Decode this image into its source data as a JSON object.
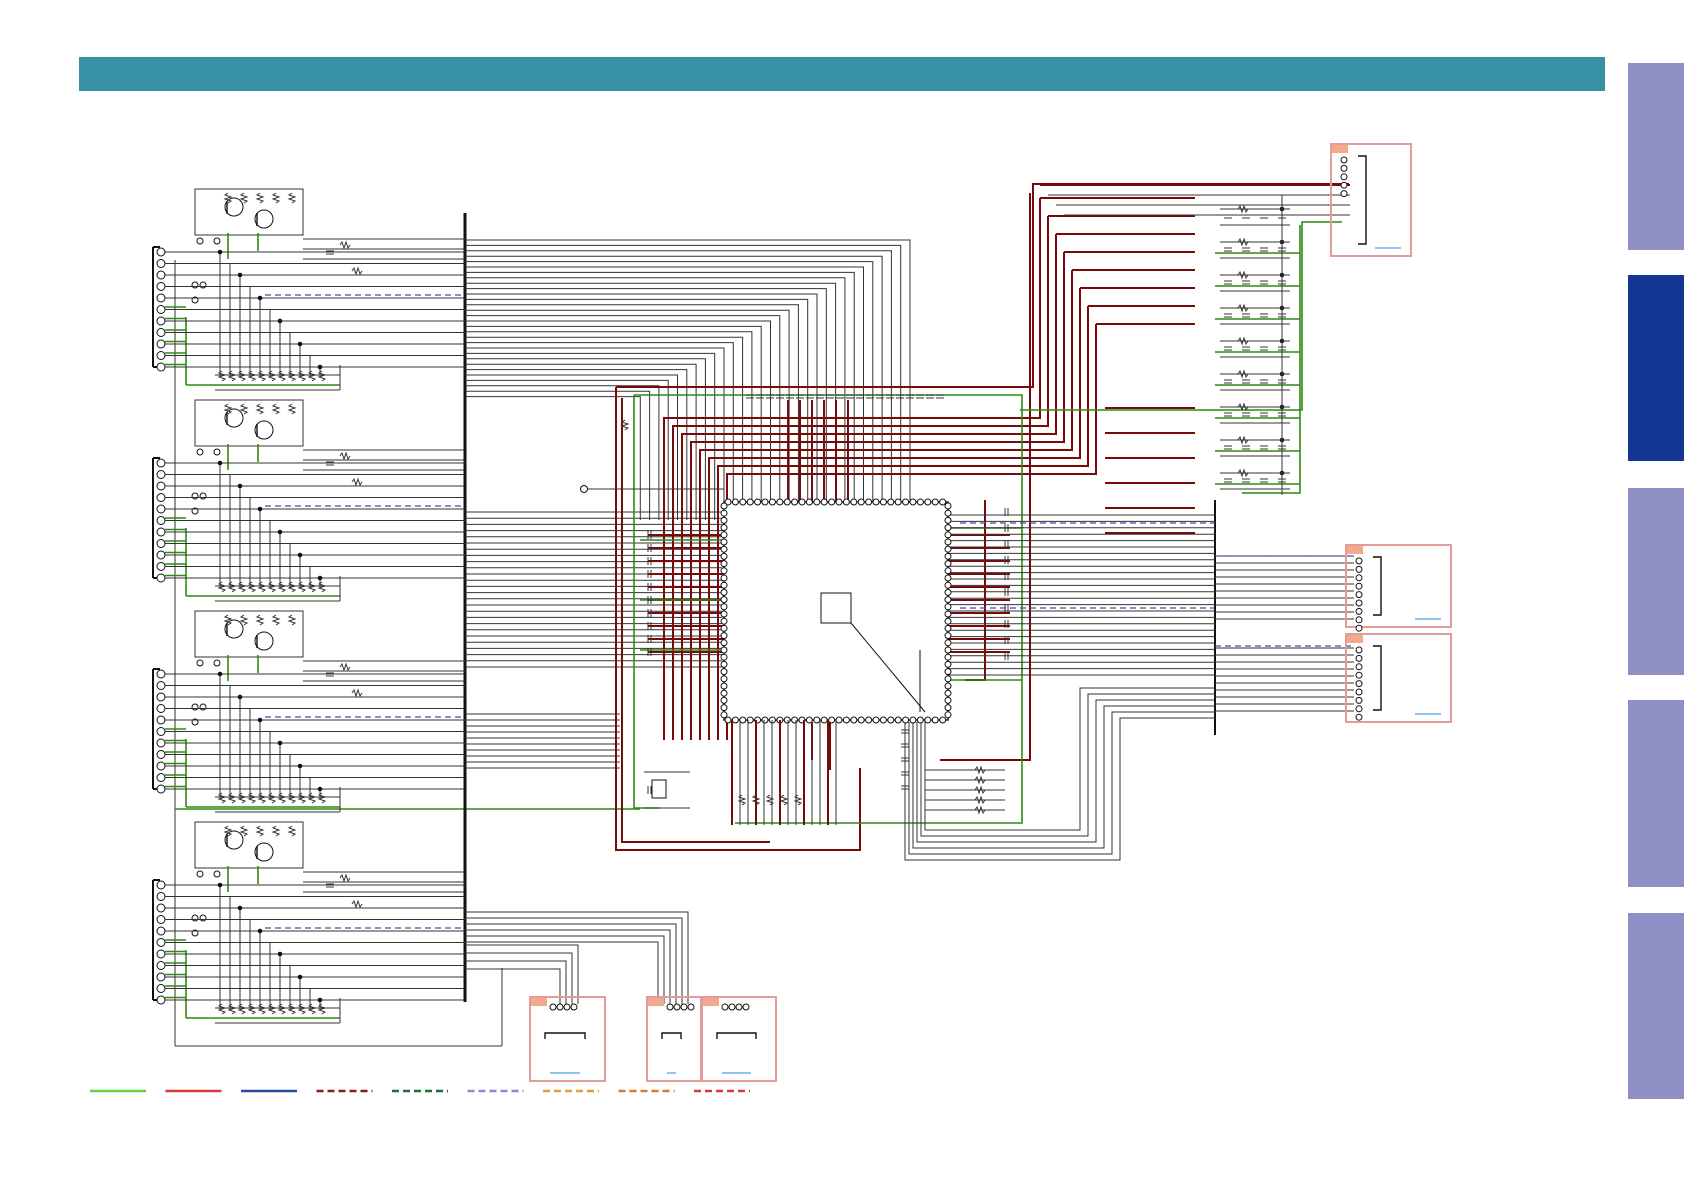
{
  "header": {
    "color": "#3690a6"
  },
  "side_tabs": [
    {
      "id": "tab-1",
      "active": false
    },
    {
      "id": "tab-2",
      "active": true
    },
    {
      "id": "tab-3",
      "active": false
    },
    {
      "id": "tab-4",
      "active": false
    },
    {
      "id": "tab-5",
      "active": false
    }
  ],
  "colors": {
    "trace_thin": "#333333",
    "trace_power": "#7a0a0a",
    "trace_ground": "#2f8a12",
    "trace_signal_dash": "#4a4aa8",
    "bus": "#111111",
    "connector_border": "#e39c9c",
    "connector_tag": "#f3a98e",
    "link": "#2a8ad8"
  },
  "legend": [
    {
      "color": "#5fd83a",
      "style": "solid"
    },
    {
      "color": "#d63a3a",
      "style": "solid"
    },
    {
      "color": "#2a4aa8",
      "style": "solid"
    },
    {
      "color": "#8a1a1a",
      "style": "dashed"
    },
    {
      "color": "#1c6f3a",
      "style": "dashed"
    },
    {
      "color": "#8a8ad8",
      "style": "dashed"
    },
    {
      "color": "#e0a040",
      "style": "dashed"
    },
    {
      "color": "#e07a2a",
      "style": "dashed"
    },
    {
      "color": "#d83a3a",
      "style": "dashed"
    }
  ]
}
